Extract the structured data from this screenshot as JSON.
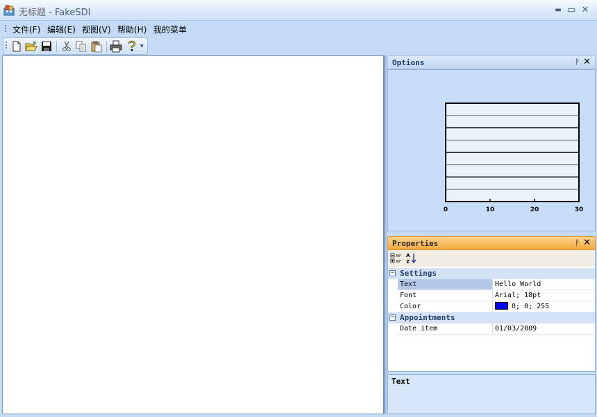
{
  "window": {
    "doc_title": "无标题",
    "separator": "-",
    "app_name": "FakeSDI",
    "minimize_glyph": "▬",
    "maximize_glyph": "▭",
    "close_glyph": "✕"
  },
  "menu": {
    "items": [
      {
        "label": "文件(F)"
      },
      {
        "label": "编辑(E)"
      },
      {
        "label": "视图(V)"
      },
      {
        "label": "帮助(H)"
      },
      {
        "label": "我的菜单"
      }
    ]
  },
  "toolbar": {
    "buttons": [
      "new-file-icon",
      "open-folder-icon",
      "save-icon",
      "cut-icon",
      "copy-icon",
      "paste-icon",
      "print-icon",
      "help-icon"
    ],
    "overflow_glyph": "▾"
  },
  "options_pane": {
    "title": "Options",
    "pin_glyph": "ᚹ",
    "close_glyph": "✕",
    "chart_data": {
      "type": "bar",
      "categories": [],
      "values": [],
      "title": "",
      "xlabel": "",
      "ylabel": "",
      "xlim": [
        0,
        30
      ],
      "xticks": [
        "0",
        "10",
        "20",
        "30"
      ],
      "band_count": 8,
      "grid": true
    }
  },
  "properties_pane": {
    "title": "Properties",
    "pin_glyph": "ᚹ",
    "close_glyph": "✕",
    "toolbar": [
      "categorized-icon",
      "alphabetical-icon"
    ],
    "categories": [
      {
        "name": "Settings",
        "toggle": "−",
        "rows": [
          {
            "name": "Text",
            "value": "Hello World",
            "selected": true
          },
          {
            "name": "Font",
            "value": "Arial; 18pt"
          },
          {
            "name": "Color",
            "value": "0; 0; 255",
            "swatch": "#0000ff"
          }
        ]
      },
      {
        "name": "Appointments",
        "toggle": "−",
        "rows": [
          {
            "name": "Date item",
            "value": "01/03/2009"
          }
        ]
      }
    ],
    "description_title": "Text"
  },
  "colors": {
    "frame": "#c4daf5",
    "properties_header": "#f6a93e",
    "selected_row": "#b4c8e8"
  }
}
